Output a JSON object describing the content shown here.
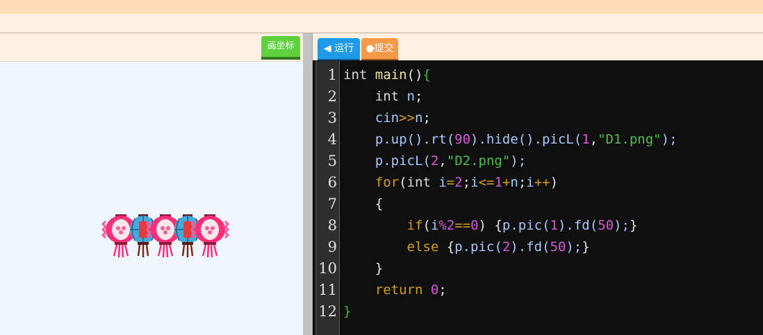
{
  "toolbar": {
    "plot_label": "画坐标",
    "run_label": "◀ 运行",
    "submit_label": "提交"
  },
  "editor": {
    "line_numbers": [
      "1",
      "2",
      "3",
      "4",
      "5",
      "6",
      "7",
      "8",
      "9",
      "10",
      "11",
      "12"
    ],
    "lines": [
      [
        {
          "c": "k-type",
          "t": "int "
        },
        {
          "c": "k-fn",
          "t": "main"
        },
        {
          "c": "k-op",
          "t": "()"
        },
        {
          "c": "k-brace",
          "t": "{"
        }
      ],
      [
        {
          "c": "k-op",
          "t": "    "
        },
        {
          "c": "k-type",
          "t": "int "
        },
        {
          "c": "k-var",
          "t": "n"
        },
        {
          "c": "k-op",
          "t": ";"
        }
      ],
      [
        {
          "c": "k-op",
          "t": "    "
        },
        {
          "c": "k-call",
          "t": "cin"
        },
        {
          "c": "k-ctrl",
          "t": ">>"
        },
        {
          "c": "k-var",
          "t": "n"
        },
        {
          "c": "k-op",
          "t": ";"
        }
      ],
      [
        {
          "c": "k-op",
          "t": "    "
        },
        {
          "c": "k-call",
          "t": "p.up().rt("
        },
        {
          "c": "k-num",
          "t": "90"
        },
        {
          "c": "k-call",
          "t": ").hide().picL("
        },
        {
          "c": "k-num",
          "t": "1"
        },
        {
          "c": "k-op",
          "t": ","
        },
        {
          "c": "k-str",
          "t": "\"D1.png\""
        },
        {
          "c": "k-call",
          "t": ");"
        }
      ],
      [
        {
          "c": "k-op",
          "t": "    "
        },
        {
          "c": "k-call",
          "t": "p.picL("
        },
        {
          "c": "k-num",
          "t": "2"
        },
        {
          "c": "k-op",
          "t": ","
        },
        {
          "c": "k-str",
          "t": "\"D2.png\""
        },
        {
          "c": "k-call",
          "t": ");"
        }
      ],
      [
        {
          "c": "k-op",
          "t": "    "
        },
        {
          "c": "k-ctrl",
          "t": "for"
        },
        {
          "c": "k-op",
          "t": "("
        },
        {
          "c": "k-type",
          "t": "int "
        },
        {
          "c": "k-var",
          "t": "i"
        },
        {
          "c": "k-ctrl",
          "t": "="
        },
        {
          "c": "k-num",
          "t": "2"
        },
        {
          "c": "k-op",
          "t": ";"
        },
        {
          "c": "k-var",
          "t": "i"
        },
        {
          "c": "k-ctrl",
          "t": "<="
        },
        {
          "c": "k-num",
          "t": "1"
        },
        {
          "c": "k-ctrl",
          "t": "+"
        },
        {
          "c": "k-var",
          "t": "n"
        },
        {
          "c": "k-op",
          "t": ";"
        },
        {
          "c": "k-var",
          "t": "i"
        },
        {
          "c": "k-ctrl",
          "t": "++"
        },
        {
          "c": "k-op",
          "t": ")"
        }
      ],
      [
        {
          "c": "k-op",
          "t": "    "
        },
        {
          "c": "k-op",
          "t": "{"
        }
      ],
      [
        {
          "c": "k-op",
          "t": "        "
        },
        {
          "c": "k-ctrl",
          "t": "if"
        },
        {
          "c": "k-op",
          "t": "("
        },
        {
          "c": "k-var",
          "t": "i"
        },
        {
          "c": "k-num",
          "t": "%2"
        },
        {
          "c": "k-ctrl",
          "t": "=="
        },
        {
          "c": "k-num",
          "t": "0"
        },
        {
          "c": "k-op",
          "t": ") "
        },
        {
          "c": "k-op",
          "t": "{"
        },
        {
          "c": "k-call",
          "t": "p.pic("
        },
        {
          "c": "k-num",
          "t": "1"
        },
        {
          "c": "k-call",
          "t": ").fd("
        },
        {
          "c": "k-num",
          "t": "50"
        },
        {
          "c": "k-call",
          "t": ");"
        },
        {
          "c": "k-op",
          "t": "}"
        }
      ],
      [
        {
          "c": "k-op",
          "t": "        "
        },
        {
          "c": "k-ctrl",
          "t": "else "
        },
        {
          "c": "k-op",
          "t": "{"
        },
        {
          "c": "k-call",
          "t": "p.pic("
        },
        {
          "c": "k-num",
          "t": "2"
        },
        {
          "c": "k-call",
          "t": ").fd("
        },
        {
          "c": "k-num",
          "t": "50"
        },
        {
          "c": "k-call",
          "t": ");"
        },
        {
          "c": "k-op",
          "t": "}"
        }
      ],
      [
        {
          "c": "k-op",
          "t": "    "
        },
        {
          "c": "k-op",
          "t": "}"
        }
      ],
      [
        {
          "c": "k-op",
          "t": "    "
        },
        {
          "c": "k-ctrl",
          "t": "return "
        },
        {
          "c": "k-num",
          "t": "0"
        },
        {
          "c": "k-op",
          "t": ";"
        }
      ],
      [
        {
          "c": "k-brace",
          "t": "}"
        }
      ]
    ]
  },
  "canvas": {
    "lantern_sequence": [
      "pink-lantern",
      "blue-lantern",
      "pink-lantern",
      "blue-lantern",
      "pink-lantern"
    ]
  }
}
